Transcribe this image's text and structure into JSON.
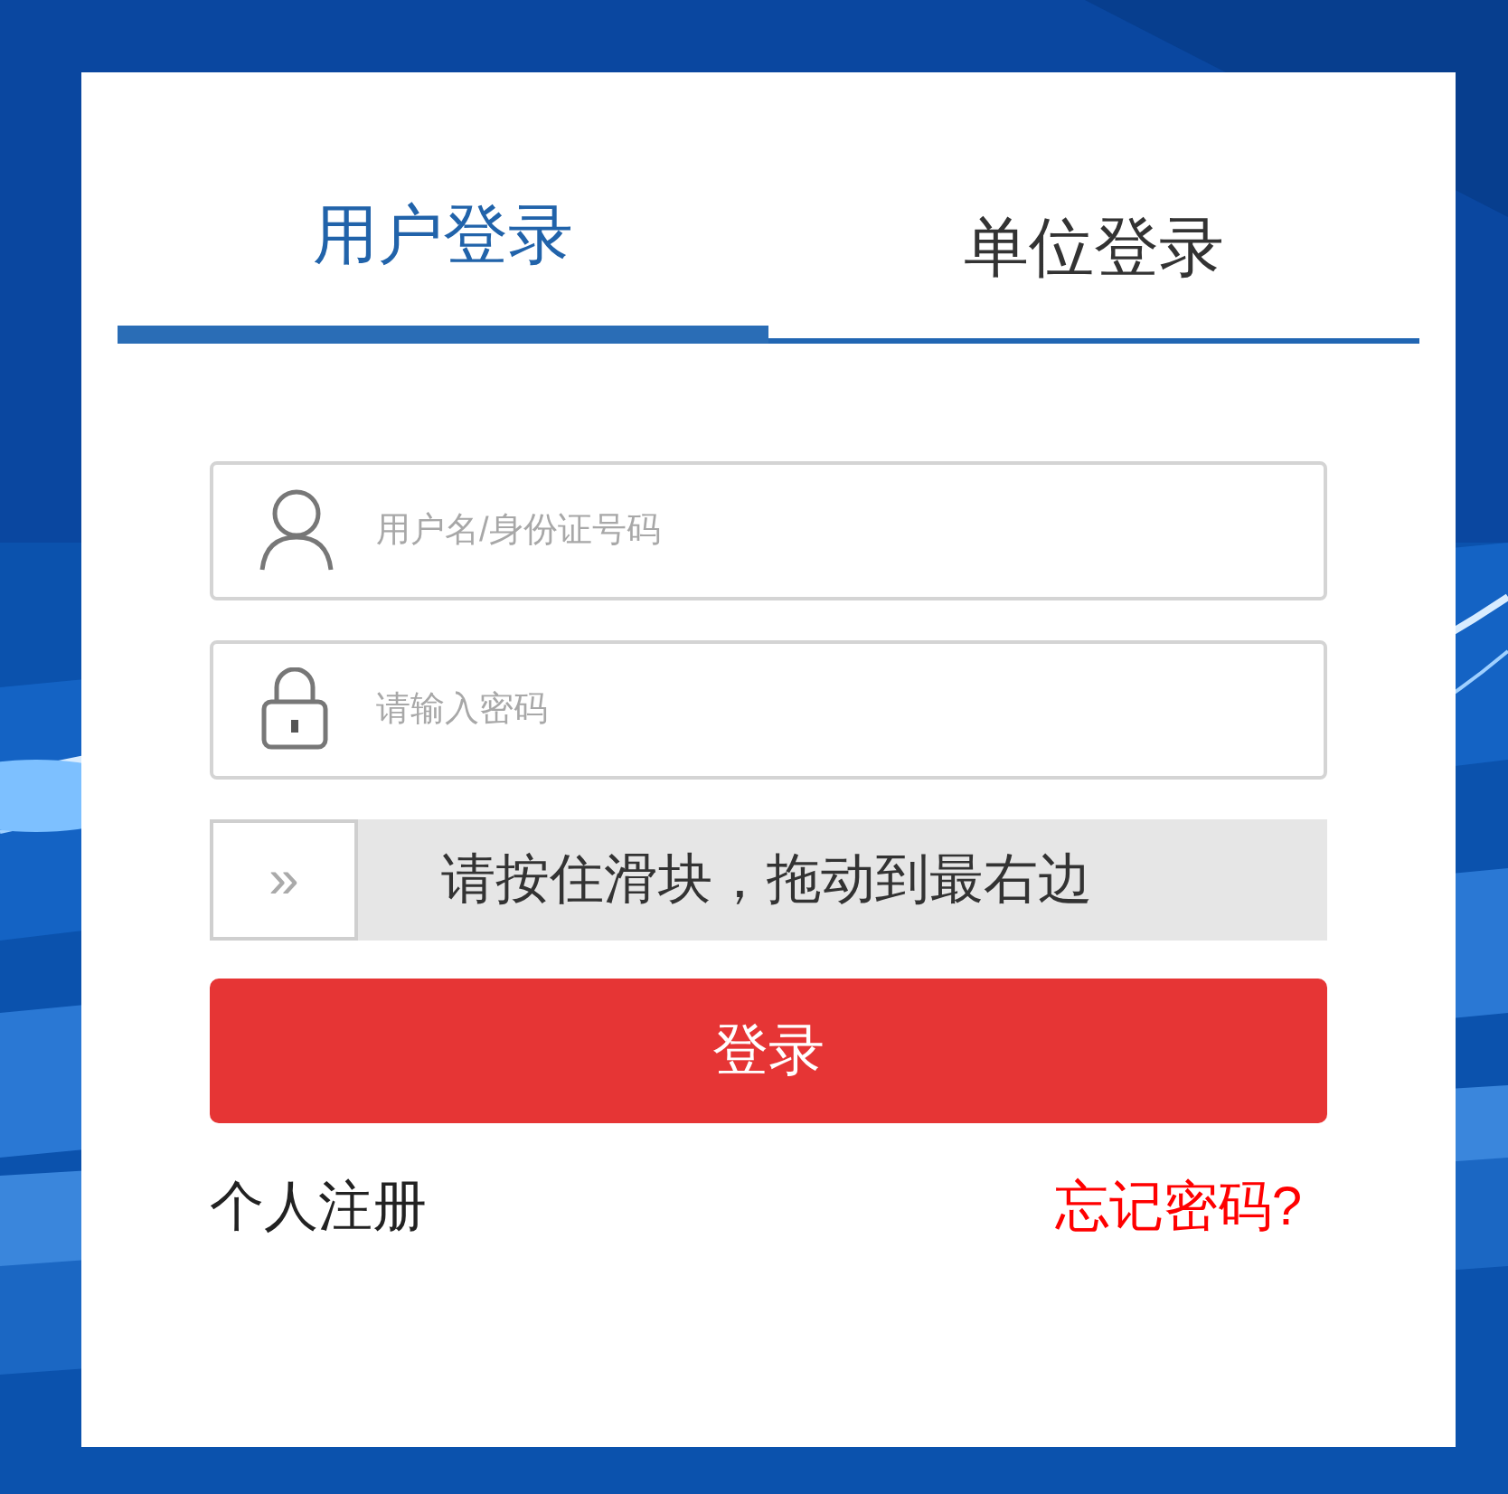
{
  "tabs": [
    {
      "label": "用户登录",
      "selected": true
    },
    {
      "label": "单位登录",
      "selected": false
    }
  ],
  "username": {
    "placeholder": "用户名/身份证号码"
  },
  "password": {
    "placeholder": "请输入密码"
  },
  "slider": {
    "handle": "»",
    "hint": "请按住滑块，拖动到最右边",
    "level": 0
  },
  "login_button": "登录",
  "links": [
    {
      "kind": "register",
      "label": "个人注册"
    },
    {
      "kind": "forgot",
      "label": "忘记密码?"
    }
  ]
}
